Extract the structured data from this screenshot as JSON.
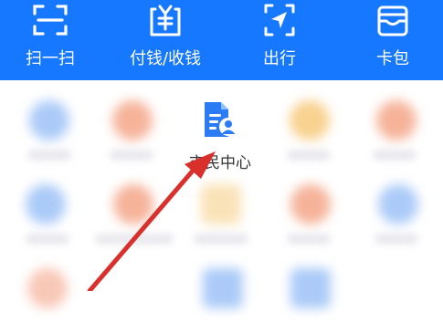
{
  "topbar": {
    "items": [
      {
        "label": "扫一扫",
        "icon": "scan-icon"
      },
      {
        "label": "付钱/收钱",
        "icon": "payment-code-icon"
      },
      {
        "label": "出行",
        "icon": "transit-icon"
      },
      {
        "label": "卡包",
        "icon": "card-wallet-icon"
      }
    ]
  },
  "grid": {
    "featured": {
      "label": "市民中心",
      "icon": "citizen-center-icon"
    }
  },
  "colors": {
    "brand": "#1677ff",
    "annotation_arrow": "#d9302b"
  }
}
